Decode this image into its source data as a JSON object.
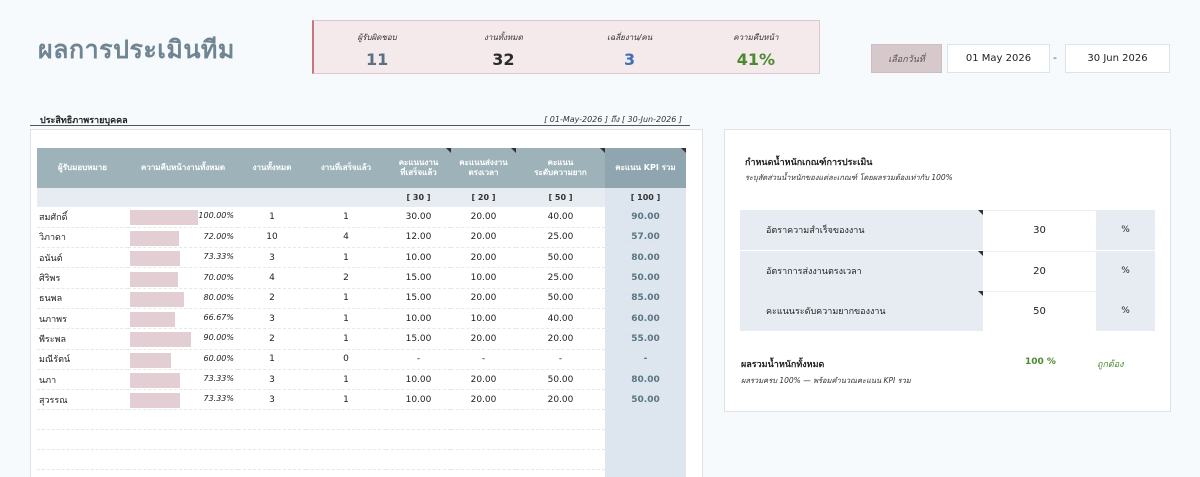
{
  "page_title": "ผลการประเมินทีม",
  "summary": [
    {
      "label": "ผู้รับผิดชอบ",
      "value": "11",
      "color": "#5b7182"
    },
    {
      "label": "งานทั้งหมด",
      "value": "32",
      "color": "#2b2b2b"
    },
    {
      "label": "เฉลี่ยงาน/คน",
      "value": "3",
      "color": "#3f6fb5"
    },
    {
      "label": "ความคืบหน้า",
      "value": "41%",
      "color": "#4c8a2f"
    }
  ],
  "date_range": {
    "label": "เลือกวันที่",
    "start": "01 May 2026",
    "separator": "-",
    "end": "30 Jun 2026"
  },
  "individual": {
    "title": "ประสิทธิภาพรายบุคคล",
    "range_text": "[ 01-May-2026 ] ถึง [ 30-Jun-2026 ]",
    "headers": {
      "owner": "ผู้รับมอบหมาย",
      "progress": "ความคืบหน้างานทั้งหมด",
      "total": "งานทั้งหมด",
      "done": "งานที่เสร็จแล้ว",
      "score_done_1": "คะแนนงาน",
      "score_done_2": "ที่เสร็จแล้ว",
      "score_ontime_1": "คะแนนส่งงาน",
      "score_ontime_2": "ตรงเวลา",
      "score_diff_1": "คะแนน",
      "score_diff_2": "ระดับความยาก",
      "kpi": "คะแนน KPI รวม"
    },
    "weights": {
      "done": "[ 30 ]",
      "ontime": "[ 20 ]",
      "diff": "[ 50 ]",
      "kpi": "[ 100 ]"
    },
    "rows": [
      {
        "name": "สมศักดิ์",
        "progress_text": "100.00%",
        "progress": 1.0,
        "total": "1",
        "done": "1",
        "s1": "30.00",
        "s2": "20.00",
        "s3": "40.00",
        "kpi": "90.00"
      },
      {
        "name": "วิภาดา",
        "progress_text": "72.00%",
        "progress": 0.72,
        "total": "10",
        "done": "4",
        "s1": "12.00",
        "s2": "20.00",
        "s3": "25.00",
        "kpi": "57.00"
      },
      {
        "name": "อนันต์",
        "progress_text": "73.33%",
        "progress": 0.7333,
        "total": "3",
        "done": "1",
        "s1": "10.00",
        "s2": "20.00",
        "s3": "50.00",
        "kpi": "80.00"
      },
      {
        "name": "ศิริพร",
        "progress_text": "70.00%",
        "progress": 0.7,
        "total": "4",
        "done": "2",
        "s1": "15.00",
        "s2": "10.00",
        "s3": "25.00",
        "kpi": "50.00"
      },
      {
        "name": "ธนพล",
        "progress_text": "80.00%",
        "progress": 0.8,
        "total": "2",
        "done": "1",
        "s1": "15.00",
        "s2": "20.00",
        "s3": "50.00",
        "kpi": "85.00"
      },
      {
        "name": "นภาพร",
        "progress_text": "66.67%",
        "progress": 0.6667,
        "total": "3",
        "done": "1",
        "s1": "10.00",
        "s2": "10.00",
        "s3": "40.00",
        "kpi": "60.00"
      },
      {
        "name": "พีระพล",
        "progress_text": "90.00%",
        "progress": 0.9,
        "total": "2",
        "done": "1",
        "s1": "15.00",
        "s2": "20.00",
        "s3": "20.00",
        "kpi": "55.00"
      },
      {
        "name": "มณีรัตน์",
        "progress_text": "60.00%",
        "progress": 0.6,
        "total": "1",
        "done": "0",
        "s1": "-",
        "s2": "-",
        "s3": "-",
        "kpi": "-"
      },
      {
        "name": "นภา",
        "progress_text": "73.33%",
        "progress": 0.7333,
        "total": "3",
        "done": "1",
        "s1": "10.00",
        "s2": "20.00",
        "s3": "50.00",
        "kpi": "80.00"
      },
      {
        "name": "สุวรรณ",
        "progress_text": "73.33%",
        "progress": 0.7333,
        "total": "3",
        "done": "1",
        "s1": "10.00",
        "s2": "20.00",
        "s3": "20.00",
        "kpi": "50.00"
      }
    ]
  },
  "weights_panel": {
    "title": "กำหนดน้ำหนักเกณฑ์การประเมิน",
    "subtitle": "ระบุสัดส่วนน้ำหนักของแต่ละเกณฑ์ โดยผลรวมต้องเท่ากับ 100%",
    "items": [
      {
        "label": "อัตราความสำเร็จของงาน",
        "value": "30",
        "unit": "%"
      },
      {
        "label": "อัตราการส่งงานตรงเวลา",
        "value": "20",
        "unit": "%"
      },
      {
        "label": "คะแนนระดับความยากของงาน",
        "value": "50",
        "unit": "%"
      }
    ],
    "total_label": "ผลรวมน้ำหนักทั้งหมด",
    "total_value": "100 %",
    "total_status": "ถูกต้อง",
    "total_note": "ผลรวมครบ 100% — พร้อมคำนวณคะแนน KPI รวม"
  }
}
